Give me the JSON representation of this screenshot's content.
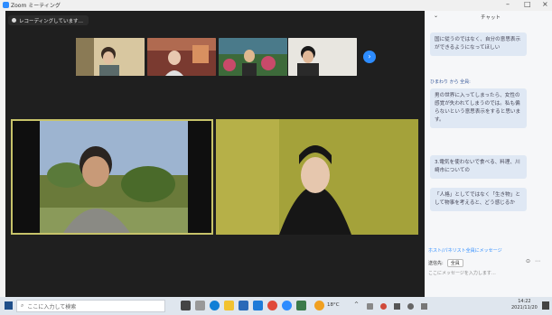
{
  "window": {
    "title": "Zoom ミーティング"
  },
  "recording": {
    "label": "レコーディングしています…"
  },
  "chat": {
    "header": "チャット",
    "messages": [
      {
        "text": "国に従うのではなく、自分の意思表示ができるようになってほしい"
      },
      {
        "sender": "ひまわり から 全員:"
      },
      {
        "text": "男の世界に入ってしまったら、女性の感覚が失われてしまうのでは。私も偏らないという意思表示をすると思います。"
      },
      {
        "text": "3.電気を使わないで食べる、料理、川崎市についての"
      },
      {
        "text": "「人格」としてではなく「生き物」として物事を考えると、どう感じるか"
      }
    ],
    "recipients_link": "ホスト/パネリスト全員にメッセージ",
    "to_label": "送信先:",
    "to_value": "全員",
    "input_placeholder": "ここにメッセージを入力します…"
  },
  "taskbar": {
    "search_placeholder": "ここに入力して検索",
    "temp": "18°C",
    "time": "14:22",
    "date": "2021/11/20"
  },
  "colors": {
    "accent": "#2d8cff",
    "active_speaker_border": "#c7c36a",
    "meeting_bg": "#1f1f1f"
  }
}
